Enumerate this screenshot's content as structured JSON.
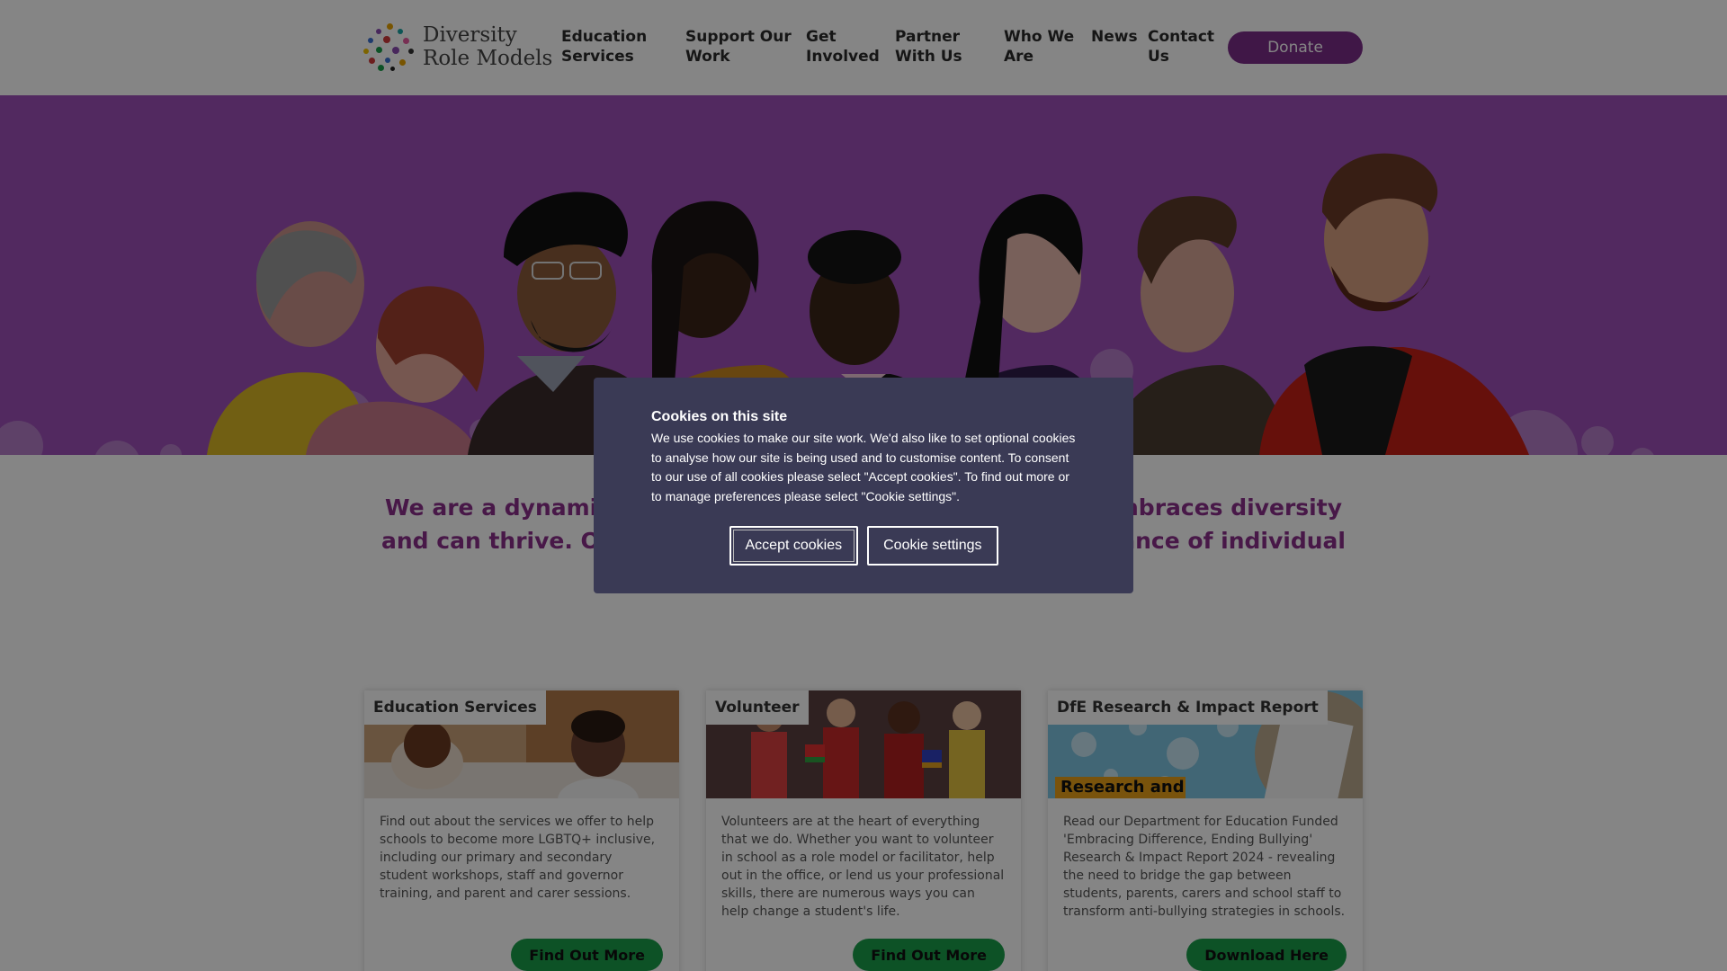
{
  "header": {
    "logo_line1": "Diversity",
    "logo_line2": "Role Models",
    "nav": [
      {
        "label": "Education\nServices"
      },
      {
        "label": "Support Our\nWork"
      },
      {
        "label": "Get\nInvolved"
      },
      {
        "label": "Partner\nWith Us"
      },
      {
        "label": "Who We\nAre"
      },
      {
        "label": "News"
      },
      {
        "label": "Contact\nUs"
      }
    ],
    "donate_label": "Donate"
  },
  "mission": {
    "line1_left": "We are a dynamic c",
    "line1_right": "embraces diversity",
    "line2_left": "and can thrive. Our",
    "line2_right": "ptance of individual"
  },
  "cards": [
    {
      "title": "Education Services",
      "body": "Find out about the services we offer to help schools to become more LGBTQ+ inclusive, including our primary and secondary student workshops, staff and governor training, and parent and carer sessions.",
      "button": "Find Out More"
    },
    {
      "title": "Volunteer",
      "body": "Volunteers are at the heart of everything that we do. Whether you want to volunteer in school as a role model or facilitator, help out in the office, or lend us your professional skills, there are numerous ways you can help change a student's life.",
      "button": "Find Out More"
    },
    {
      "title": "DfE Research & Impact Report",
      "image_text": "Research and",
      "body": "Read our Department for Education Funded 'Embracing Difference, Ending Bullying' Research & Impact Report 2024 - revealing the need to bridge the gap between students, parents, carers and school staff to transform anti-bullying strategies in schools.",
      "button": "Download Here"
    }
  ],
  "cookie_banner": {
    "title": "Cookies on this site",
    "text": "We use cookies to make our site work. We'd also like to set optional cookies to analyse how our site is being used and to customise content. To consent to our use of all cookies please select \"Accept cookies\". To find out more or to manage preferences please select \"Cookie settings\".",
    "accept_label": "Accept cookies",
    "settings_label": "Cookie settings"
  },
  "colors": {
    "brand_purple": "#7b2d88",
    "hero_purple": "#9e4fb8",
    "mission_text": "#8a2e8a",
    "button_green": "#1a9e4a",
    "cookie_bg": "#3a3a55"
  },
  "icons": {
    "logo": "multicolor-dots-logo"
  }
}
